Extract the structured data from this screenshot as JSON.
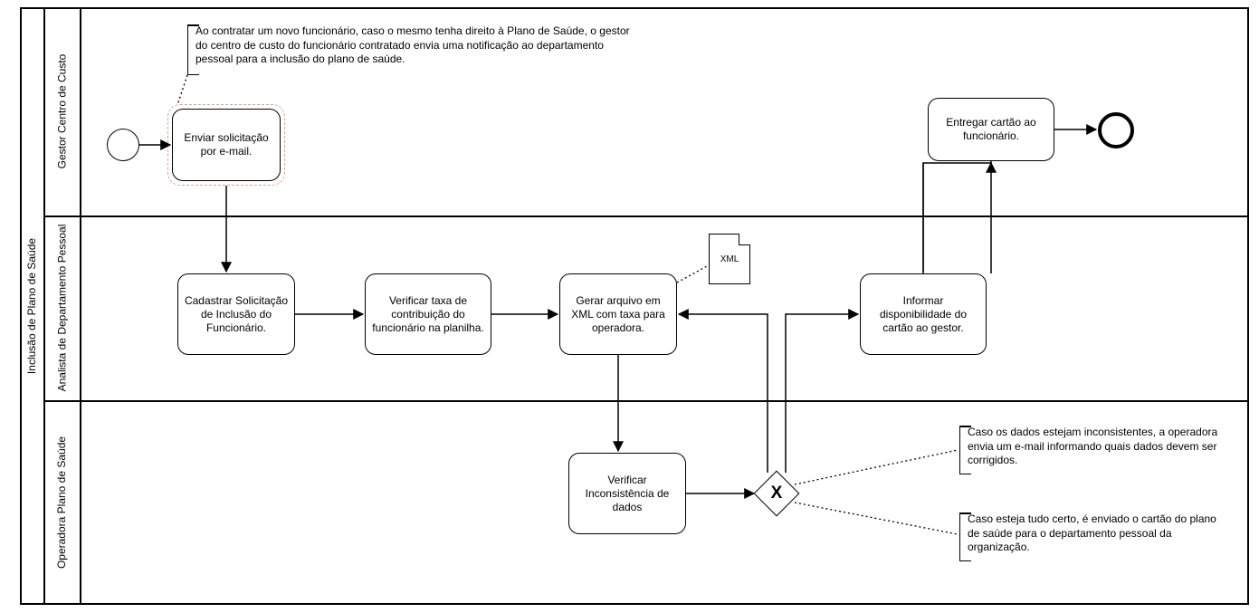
{
  "pool": {
    "title": "Inclusão de Plano de Saúde"
  },
  "lanes": {
    "l1": "Gestor Centro de Custo",
    "l2": "Analista de Departamento Pessoal",
    "l3": "Operadora Plano de Saúde"
  },
  "tasks": {
    "t1": "Enviar solicitação por e-mail.",
    "t2": "Cadastrar Solicitação de Inclusão do Funcionário.",
    "t3": "Verificar taxa de contribuição do funcionário na planilha.",
    "t4": "Gerar arquivo em XML com taxa para operadora.",
    "t5": "Verificar Inconsistência de dados",
    "t6": "Informar disponibilidade do cartão ao gestor.",
    "t7": "Entregar cartão ao funcionário."
  },
  "data_objects": {
    "d1": "XML"
  },
  "gateways": {
    "g1": "X"
  },
  "annotations": {
    "a1": "Ao contratar um novo funcionário, caso o mesmo tenha direito à Plano de Saúde, o gestor do centro de custo do funcionário contratado envia uma notificação ao departamento pessoal para a inclusão do plano de saúde.",
    "a2": "Caso os dados estejam inconsistentes, a operadora envia um e-mail informando quais dados devem ser corrigidos.",
    "a3": "Caso esteja tudo certo, é enviado o cartão do plano de saúde para o departamento pessoal da organização."
  }
}
